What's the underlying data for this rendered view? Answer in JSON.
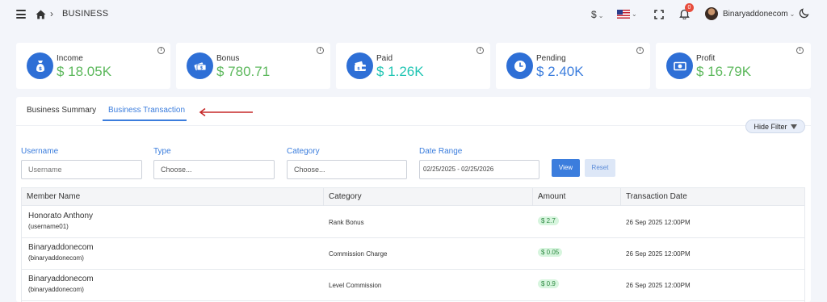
{
  "header": {
    "breadcrumb_separator": "›",
    "title": "BUSINESS",
    "currency": "$",
    "notifications_count": "0",
    "username": "Binaryaddonecom"
  },
  "cards": [
    {
      "label": "Income",
      "value": "$ 18.05K",
      "icon": "money-bag-icon",
      "color": "#5cb85c"
    },
    {
      "label": "Bonus",
      "value": "$ 780.71",
      "icon": "cash-icon",
      "color": "#5cb85c"
    },
    {
      "label": "Paid",
      "value": "$ 1.26K",
      "icon": "wallet-icon",
      "color": "#20c5b3"
    },
    {
      "label": "Pending",
      "value": "$ 2.40K",
      "icon": "clock-icon",
      "color": "#3b7ddd"
    },
    {
      "label": "Profit",
      "value": "$ 16.79K",
      "icon": "banknote-icon",
      "color": "#5cb85c"
    }
  ],
  "tabs": [
    {
      "label": "Business Summary",
      "active": false
    },
    {
      "label": "Business Transaction",
      "active": true
    }
  ],
  "hide_filter_label": "Hide Filter",
  "filters": {
    "username": {
      "label": "Username",
      "placeholder": "Username"
    },
    "type": {
      "label": "Type",
      "value": "Choose..."
    },
    "category": {
      "label": "Category",
      "value": "Choose..."
    },
    "date_range": {
      "label": "Date Range",
      "value": "02/25/2025 - 02/25/2026"
    },
    "view_label": "View",
    "reset_label": "Reset"
  },
  "table": {
    "columns": [
      "Member Name",
      "Category",
      "Amount",
      "Transaction Date"
    ],
    "rows": [
      {
        "name": "Honorato Anthony",
        "username": "(username01)",
        "category": "Rank Bonus",
        "amount": "$ 2.7",
        "date": "26 Sep 2025 12:00PM"
      },
      {
        "name": "Binaryaddonecom",
        "username": "(binaryaddonecom)",
        "category": "Commission Charge",
        "amount": "$ 0.05",
        "date": "26 Sep 2025 12:00PM"
      },
      {
        "name": "Binaryaddonecom",
        "username": "(binaryaddonecom)",
        "category": "Level Commission",
        "amount": "$ 0.9",
        "date": "26 Sep 2025 12:00PM"
      }
    ]
  }
}
